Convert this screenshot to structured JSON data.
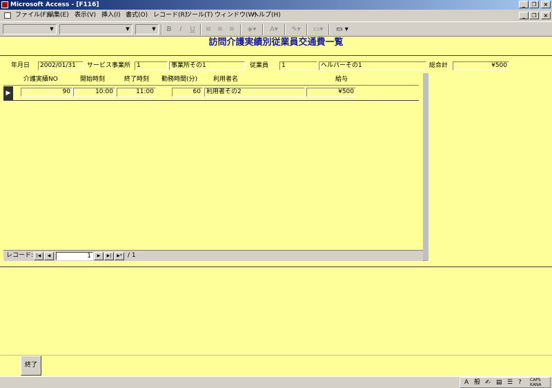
{
  "window": {
    "title": "Microsoft Access - [F116]"
  },
  "menu": [
    "ファイル(F)",
    "編集(E)",
    "表示(V)",
    "挿入(I)",
    "書式(O)",
    "レコード(R)",
    "ツール(T)",
    "ウィンドウ(W)",
    "ヘルプ(H)"
  ],
  "toolbar": {
    "bold": "B",
    "italic": "I",
    "underline": "U"
  },
  "form": {
    "title": "訪問介護実績別従業員交通費一覧",
    "date_label": "年月日",
    "date_value": "2002/01/31",
    "office_label": "サービス事業所",
    "office_code": "1",
    "office_name": "事業所その1",
    "employee_label": "従業員",
    "employee_code": "1",
    "employee_name": "ヘルパーその1",
    "total_label": "総合計",
    "total_value": "¥500"
  },
  "subform": {
    "columns": [
      "介護実績NO",
      "開始時刻",
      "終了時刻",
      "勤務時間(分)",
      "利用者名",
      "給与"
    ],
    "rows": [
      {
        "no": "90",
        "start": "10:00",
        "end": "11:00",
        "minutes": "60",
        "client": "利用者その2",
        "pay": "¥500"
      }
    ],
    "nav": {
      "label": "レコード:",
      "current": "1",
      "total": "/ 1"
    }
  },
  "footer": {
    "close_label": "終了"
  },
  "ime": {
    "mode": "A",
    "kanji": "般",
    "caps": "CAPS",
    "kana": "KANA"
  },
  "colors": {
    "form_bg": "#ffff99",
    "title_color": "#1a1aa0",
    "titlebar": "#0a246a"
  }
}
